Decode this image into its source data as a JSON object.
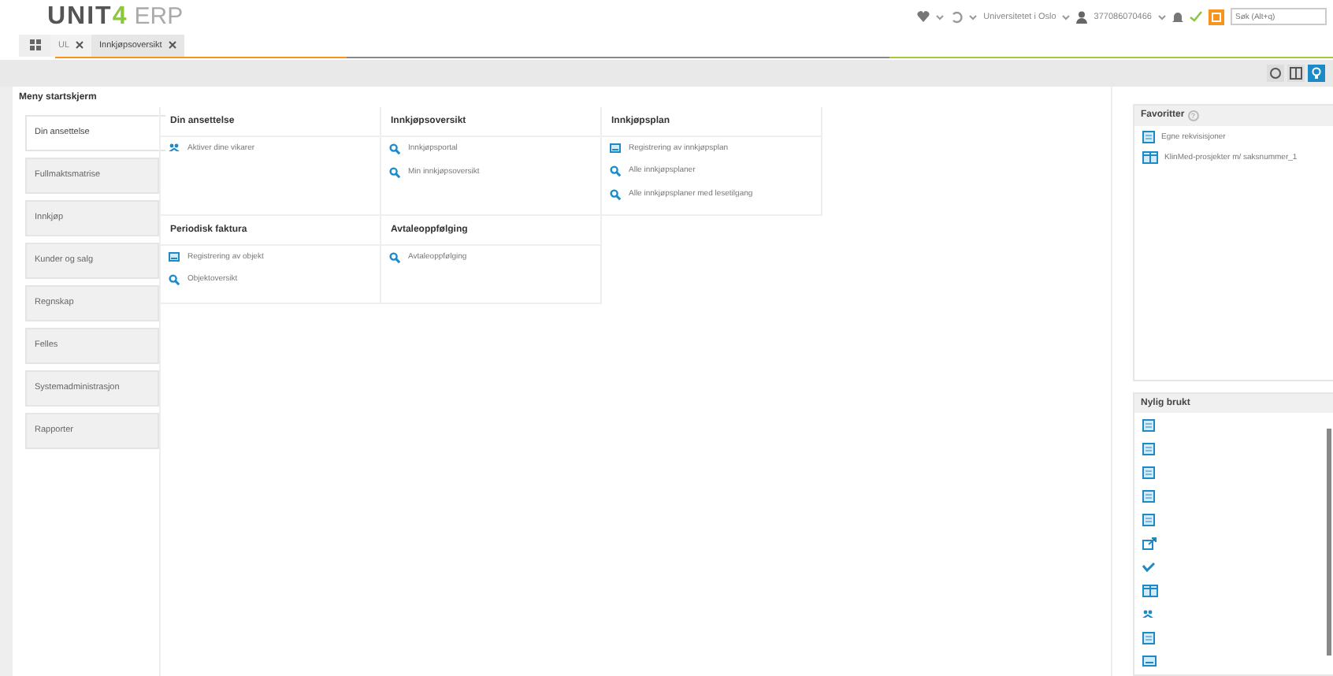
{
  "logo": {
    "brand": "UNIT",
    "brand_mark": "4",
    "product": "ERP"
  },
  "topbar": {
    "company": "Universitetet i Oslo",
    "user": "377086070466",
    "search": {
      "placeholder": "Søk (Alt+q)"
    }
  },
  "tabs": [
    {
      "label": "UL",
      "selected": false
    },
    {
      "label": "Innkjøpsoversikt",
      "selected": true
    }
  ],
  "page_title": "Meny startskjerm",
  "sidebar": {
    "items": [
      {
        "label": "Din ansettelse",
        "selected": true
      },
      {
        "label": "Fullmaktsmatrise",
        "selected": false
      },
      {
        "label": "Innkjøp",
        "selected": false
      },
      {
        "label": "Kunder og salg",
        "selected": false
      },
      {
        "label": "Regnskap",
        "selected": false
      },
      {
        "label": "Felles",
        "selected": false
      },
      {
        "label": "Systemadministrasjon",
        "selected": false
      },
      {
        "label": "Rapporter",
        "selected": false
      }
    ]
  },
  "groups": [
    {
      "title": "Din ansettelse",
      "items": [
        {
          "label": "Aktiver dine vikarer",
          "kind": "people"
        }
      ]
    },
    {
      "title": "Innkjøpsoversikt",
      "items": [
        {
          "label": "Innkjøpsportal",
          "kind": "search"
        },
        {
          "label": "Min innkjøpsoversikt",
          "kind": "search"
        }
      ]
    },
    {
      "title": "Innkjøpsplan",
      "items": [
        {
          "label": "Registrering av innkjøpsplan",
          "kind": "form"
        },
        {
          "label": "Alle innkjøpsplaner",
          "kind": "search"
        },
        {
          "label": "Alle innkjøpsplaner med lesetilgang",
          "kind": "search"
        }
      ]
    },
    {
      "title": "Periodisk faktura",
      "items": [
        {
          "label": "Registrering av objekt",
          "kind": "form"
        },
        {
          "label": "Objektoversikt",
          "kind": "search"
        }
      ]
    },
    {
      "title": "Avtaleoppfølging",
      "items": [
        {
          "label": "Avtaleoppfølging",
          "kind": "search"
        }
      ]
    }
  ],
  "favorites": {
    "title": "Favoritter",
    "help": "?",
    "items": [
      {
        "label": "Egne rekvisisjoner",
        "kind": "doc"
      },
      {
        "label": "KlinMed-prosjekter m/ saksnummer_1",
        "kind": "table"
      }
    ]
  },
  "recent": {
    "title": "Nylig brukt",
    "items": [
      {
        "kind": "doc"
      },
      {
        "kind": "doc"
      },
      {
        "kind": "doc"
      },
      {
        "kind": "doc"
      },
      {
        "kind": "doc"
      },
      {
        "kind": "external"
      },
      {
        "kind": "check"
      },
      {
        "kind": "table"
      },
      {
        "kind": "people"
      },
      {
        "kind": "doc"
      },
      {
        "kind": "form"
      }
    ]
  }
}
